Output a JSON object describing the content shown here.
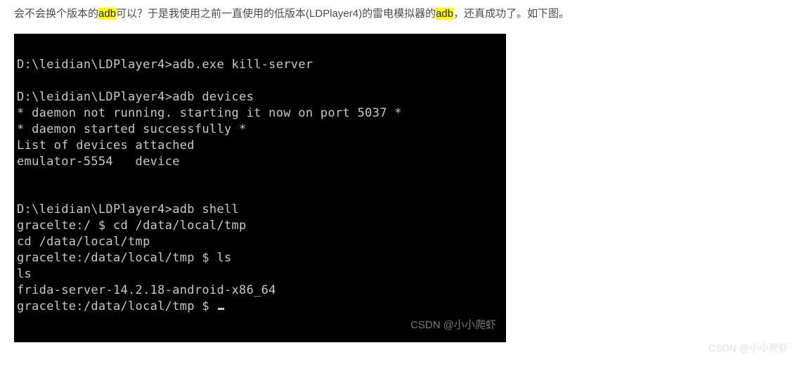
{
  "paragraph": {
    "part1": "会不会换个版本的",
    "hl1": "adb",
    "part2": "可以？于是我使用之前一直使用的低版本(LDPlayer4)的雷电模拟器的",
    "hl2": "adb",
    "part3": "，还真成功了。如下图。"
  },
  "terminal": {
    "line1": "D:\\leidian\\LDPlayer4>adb.exe kill-server",
    "blank1": " ",
    "line2": "D:\\leidian\\LDPlayer4>adb devices",
    "line3": "* daemon not running. starting it now on port 5037 *",
    "line4": "* daemon started successfully *",
    "line5": "List of devices attached",
    "line6": "emulator-5554   device",
    "blank2": " ",
    "blank3": " ",
    "line7": "D:\\leidian\\LDPlayer4>adb shell",
    "line8": "gracelte:/ $ cd /data/local/tmp",
    "line9": "cd /data/local/tmp",
    "line10": "gracelte:/data/local/tmp $ ls",
    "line11": "ls",
    "line12": "frida-server-14.2.18-android-x86_64",
    "line13": "gracelte:/data/local/tmp $ "
  },
  "watermark_inner": "CSDN @小小爬虾",
  "watermark_outer": "CSDN @小小爬虾"
}
